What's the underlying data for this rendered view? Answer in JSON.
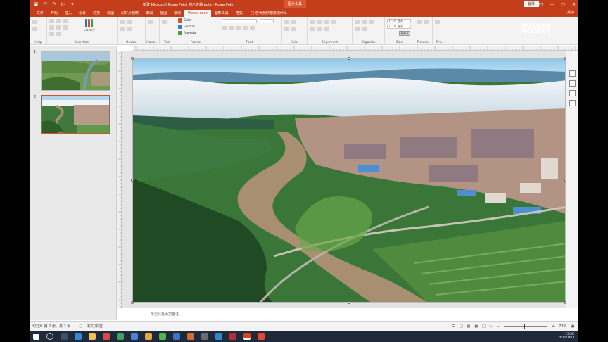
{
  "window": {
    "title": "新建 Microsoft PowerPoint 演示文稿.pptx - PowerPoint",
    "context_tab_title": "图片工具",
    "sign_in": "登录",
    "share": "共享"
  },
  "tabs": [
    {
      "label": "文件"
    },
    {
      "label": "开始"
    },
    {
      "label": "插入"
    },
    {
      "label": "设计"
    },
    {
      "label": "切换"
    },
    {
      "label": "动画"
    },
    {
      "label": "幻灯片放映"
    },
    {
      "label": "审阅"
    },
    {
      "label": "视图"
    },
    {
      "label": "帮助"
    },
    {
      "label": "Power-user",
      "active": true
    },
    {
      "label": "图形工具"
    },
    {
      "label": "格式"
    }
  ],
  "tell_me": "告诉我你想要做什么",
  "ribbon": {
    "groups": [
      {
        "label": "Help"
      },
      {
        "label": "Insertion"
      },
      {
        "label": "Resize"
      },
      {
        "label": "Harm..."
      },
      {
        "label": "Text"
      },
      {
        "label": "Format"
      },
      {
        "label": "Font"
      },
      {
        "label": "Color"
      },
      {
        "label": "Alignment"
      },
      {
        "label": "Organize"
      },
      {
        "label": "Size"
      },
      {
        "label": "Pictures"
      },
      {
        "label": "Pre..."
      }
    ],
    "library_label": "Library",
    "color_btn": "Color",
    "format_btn": "Format",
    "agenda_btn": "Agenda",
    "size_w": "17.57 厘米",
    "size_h": "11.07 厘米",
    "lock_btn": "Lock"
  },
  "slides": [
    {
      "number": "1"
    },
    {
      "number": "2",
      "selected": true
    }
  ],
  "notes_placeholder": "单击此处添加备注",
  "status": {
    "slide_info": "幻灯片 第 2 张，共 2 张",
    "language": "中文(中国)",
    "zoom": "78%"
  },
  "clock": {
    "time": "13:20",
    "date": "2021/10/1"
  },
  "watermark": "梨视频",
  "colors": {
    "accent": "#c43e1c",
    "selected_thumb": "#d35230"
  }
}
